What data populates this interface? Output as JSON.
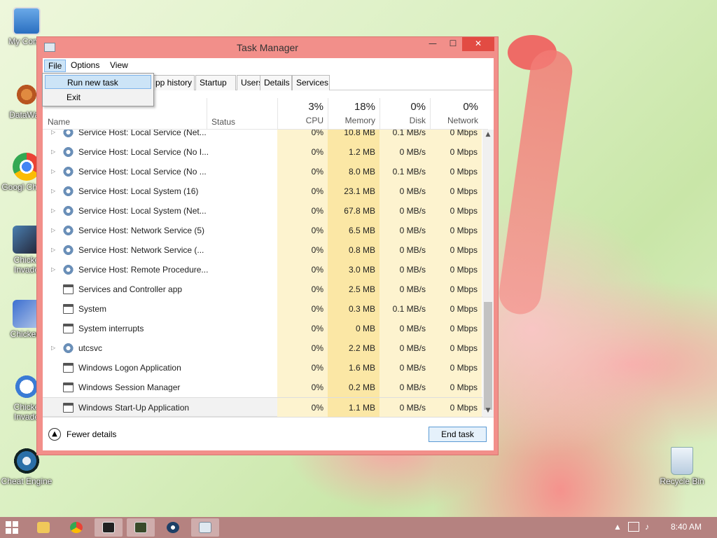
{
  "desktop": {
    "icons": [
      {
        "label": "My Comp"
      },
      {
        "label": "DataWag"
      },
      {
        "label": "Googl Chrom"
      },
      {
        "label": "Chicke Invade"
      },
      {
        "label": "ChickenI"
      },
      {
        "label": "Chicke Invade"
      },
      {
        "label": "Cheat Engine"
      },
      {
        "label": "Recycle Bin"
      }
    ]
  },
  "window": {
    "title": "Task Manager",
    "minimize": "—",
    "maximize": "☐",
    "close": "✕"
  },
  "menu": {
    "file": "File",
    "options": "Options",
    "view": "View"
  },
  "file_menu": {
    "items": [
      "Run new task",
      "Exit"
    ]
  },
  "tabs": [
    "pp history",
    "Startup",
    "Users",
    "Details",
    "Services"
  ],
  "header": {
    "name": "Name",
    "status": "Status",
    "cpu": {
      "pct": "3%",
      "label": "CPU"
    },
    "memory": {
      "pct": "18%",
      "label": "Memory"
    },
    "disk": {
      "pct": "0%",
      "label": "Disk"
    },
    "network": {
      "pct": "0%",
      "label": "Network"
    }
  },
  "processes": [
    {
      "name": "Service Host: Local Service (Net...",
      "cpu": "0%",
      "mem": "10.8 MB",
      "disk": "0.1 MB/s",
      "net": "0 Mbps",
      "expandable": true,
      "icon": "gear"
    },
    {
      "name": "Service Host: Local Service (No I...",
      "cpu": "0%",
      "mem": "1.2 MB",
      "disk": "0 MB/s",
      "net": "0 Mbps",
      "expandable": true,
      "icon": "gear"
    },
    {
      "name": "Service Host: Local Service (No ...",
      "cpu": "0%",
      "mem": "8.0 MB",
      "disk": "0.1 MB/s",
      "net": "0 Mbps",
      "expandable": true,
      "icon": "gear"
    },
    {
      "name": "Service Host: Local System (16)",
      "cpu": "0%",
      "mem": "23.1 MB",
      "disk": "0 MB/s",
      "net": "0 Mbps",
      "expandable": true,
      "icon": "gear"
    },
    {
      "name": "Service Host: Local System (Net...",
      "cpu": "0%",
      "mem": "67.8 MB",
      "disk": "0 MB/s",
      "net": "0 Mbps",
      "expandable": true,
      "icon": "gear"
    },
    {
      "name": "Service Host: Network Service (5)",
      "cpu": "0%",
      "mem": "6.5 MB",
      "disk": "0 MB/s",
      "net": "0 Mbps",
      "expandable": true,
      "icon": "gear"
    },
    {
      "name": "Service Host: Network Service (...",
      "cpu": "0%",
      "mem": "0.8 MB",
      "disk": "0 MB/s",
      "net": "0 Mbps",
      "expandable": true,
      "icon": "gear"
    },
    {
      "name": "Service Host: Remote Procedure...",
      "cpu": "0%",
      "mem": "3.0 MB",
      "disk": "0 MB/s",
      "net": "0 Mbps",
      "expandable": true,
      "icon": "gear"
    },
    {
      "name": "Services and Controller app",
      "cpu": "0%",
      "mem": "2.5 MB",
      "disk": "0 MB/s",
      "net": "0 Mbps",
      "expandable": false,
      "icon": "app"
    },
    {
      "name": "System",
      "cpu": "0%",
      "mem": "0.3 MB",
      "disk": "0.1 MB/s",
      "net": "0 Mbps",
      "expandable": false,
      "icon": "app"
    },
    {
      "name": "System interrupts",
      "cpu": "0%",
      "mem": "0 MB",
      "disk": "0 MB/s",
      "net": "0 Mbps",
      "expandable": false,
      "icon": "app"
    },
    {
      "name": "utcsvc",
      "cpu": "0%",
      "mem": "2.2 MB",
      "disk": "0 MB/s",
      "net": "0 Mbps",
      "expandable": true,
      "icon": "gear"
    },
    {
      "name": "Windows Logon Application",
      "cpu": "0%",
      "mem": "1.6 MB",
      "disk": "0 MB/s",
      "net": "0 Mbps",
      "expandable": false,
      "icon": "app"
    },
    {
      "name": "Windows Session Manager",
      "cpu": "0%",
      "mem": "0.2 MB",
      "disk": "0 MB/s",
      "net": "0 Mbps",
      "expandable": false,
      "icon": "app"
    },
    {
      "name": "Windows Start-Up Application",
      "cpu": "0%",
      "mem": "1.1 MB",
      "disk": "0 MB/s",
      "net": "0 Mbps",
      "expandable": false,
      "icon": "app",
      "selected": true
    }
  ],
  "footer": {
    "fewer_details": "Fewer details",
    "end_task": "End task"
  },
  "taskbar": {
    "clock": "8:40 AM",
    "apps": [
      "file-explorer",
      "chrome",
      "7zip",
      "chicken-invaders",
      "cheat-engine",
      "task-manager"
    ]
  },
  "colors": {
    "accent": "#f28f8a",
    "highlight": "#cce4f7",
    "heat_light": "#fdf3cf",
    "heat_mid": "#fbe7a5"
  }
}
